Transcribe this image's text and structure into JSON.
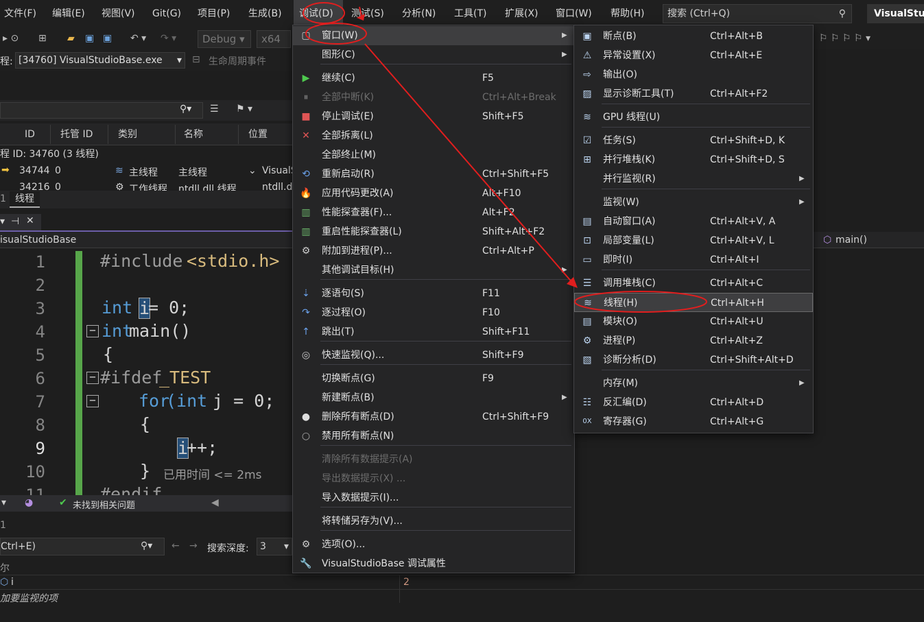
{
  "menubar": {
    "items": [
      "文件(F)",
      "编辑(E)",
      "视图(V)",
      "Git(G)",
      "项目(P)",
      "生成(B)",
      "调试(D)",
      "测试(S)",
      "分析(N)",
      "工具(T)",
      "扩展(X)",
      "窗口(W)",
      "帮助(H)"
    ],
    "search_placeholder": "搜索 (Ctrl+Q)",
    "title": "VisualStudioBase"
  },
  "toolbar": {
    "config": "Debug",
    "platform": "x64",
    "process_label": "程:",
    "process": "[34760] VisualStudioBase.exe",
    "lifecycle": "生命周期事件"
  },
  "threads": {
    "columns": [
      "ID",
      "托管 ID",
      "类别",
      "名称",
      "位置"
    ],
    "group": "程 ID: 34760 (3 线程)",
    "rows": [
      {
        "id": "34744",
        "mid": "0",
        "cat": "主线程",
        "name": "主线程",
        "loc": "VisualS"
      },
      {
        "id": "34216",
        "mid": "0",
        "cat": "工作线程",
        "name": "ntdll.dll 线程",
        "loc": "ntdll.d"
      }
    ],
    "tab": "线程",
    "tab_num": "1"
  },
  "editor": {
    "file": "isualStudioBase",
    "func": "main()",
    "lines": [
      "1",
      "2",
      "3",
      "4",
      "5",
      "6",
      "7",
      "8",
      "9",
      "10",
      "11"
    ],
    "perf": "已用时间 <= 2ms"
  },
  "code": {
    "l1a": "#include",
    "l1b": "<stdio.h>",
    "l3a": "int",
    "l3b": "i",
    "l3c": " = 0;",
    "l4a": "int",
    "l4b": " main()",
    "l5": "{",
    "l6a": "#ifdef",
    "l6b": " _TEST",
    "l7a": "for",
    "l7b": " (int",
    "l7c": " j = 0;",
    "l8": "{",
    "l9a": "i",
    "l9b": "++;",
    "l10": "}",
    "l11": "#endif"
  },
  "status": {
    "issues": "未找到相关问题"
  },
  "watch": {
    "search_hint": "Ctrl+E)",
    "depth_label": "搜索深度:",
    "depth": "3",
    "name_col": "尔",
    "var": "i",
    "value": "2",
    "add_hint": "加要监视的项",
    "num": "1"
  },
  "debug_menu": [
    {
      "label": "窗口(W)",
      "sc": "",
      "sub": true
    },
    {
      "label": "图形(C)",
      "sc": "",
      "sub": true
    },
    {
      "label": "继续(C)",
      "sc": "F5"
    },
    {
      "label": "全部中断(K)",
      "sc": "Ctrl+Alt+Break",
      "dis": true
    },
    {
      "label": "停止调试(E)",
      "sc": "Shift+F5"
    },
    {
      "label": "全部拆离(L)",
      "sc": ""
    },
    {
      "label": "全部终止(M)",
      "sc": ""
    },
    {
      "label": "重新启动(R)",
      "sc": "Ctrl+Shift+F5"
    },
    {
      "label": "应用代码更改(A)",
      "sc": "Alt+F10"
    },
    {
      "label": "性能探查器(F)...",
      "sc": "Alt+F2"
    },
    {
      "label": "重启性能探查器(L)",
      "sc": "Shift+Alt+F2"
    },
    {
      "label": "附加到进程(P)...",
      "sc": "Ctrl+Alt+P"
    },
    {
      "label": "其他调试目标(H)",
      "sc": "",
      "sub": true
    },
    {
      "label": "逐语句(S)",
      "sc": "F11"
    },
    {
      "label": "逐过程(O)",
      "sc": "F10"
    },
    {
      "label": "跳出(T)",
      "sc": "Shift+F11"
    },
    {
      "label": "快速监视(Q)...",
      "sc": "Shift+F9"
    },
    {
      "label": "切换断点(G)",
      "sc": "F9"
    },
    {
      "label": "新建断点(B)",
      "sc": "",
      "sub": true
    },
    {
      "label": "删除所有断点(D)",
      "sc": "Ctrl+Shift+F9"
    },
    {
      "label": "禁用所有断点(N)",
      "sc": ""
    },
    {
      "label": "清除所有数据提示(A)",
      "sc": "",
      "dis": true
    },
    {
      "label": "导出数据提示(X) ...",
      "sc": "",
      "dis": true
    },
    {
      "label": "导入数据提示(I)...",
      "sc": ""
    },
    {
      "label": "将转储另存为(V)...",
      "sc": ""
    },
    {
      "label": "选项(O)...",
      "sc": ""
    },
    {
      "label": "VisualStudioBase 调试属性",
      "sc": ""
    }
  ],
  "window_menu": [
    {
      "label": "断点(B)",
      "sc": "Ctrl+Alt+B"
    },
    {
      "label": "异常设置(X)",
      "sc": "Ctrl+Alt+E"
    },
    {
      "label": "输出(O)",
      "sc": ""
    },
    {
      "label": "显示诊断工具(T)",
      "sc": "Ctrl+Alt+F2"
    },
    {
      "label": "GPU 线程(U)",
      "sc": ""
    },
    {
      "label": "任务(S)",
      "sc": "Ctrl+Shift+D, K"
    },
    {
      "label": "并行堆栈(K)",
      "sc": "Ctrl+Shift+D, S"
    },
    {
      "label": "并行监视(R)",
      "sc": "",
      "sub": true
    },
    {
      "label": "监视(W)",
      "sc": "",
      "sub": true
    },
    {
      "label": "自动窗口(A)",
      "sc": "Ctrl+Alt+V, A"
    },
    {
      "label": "局部变量(L)",
      "sc": "Ctrl+Alt+V, L"
    },
    {
      "label": "即时(I)",
      "sc": "Ctrl+Alt+I"
    },
    {
      "label": "调用堆栈(C)",
      "sc": "Ctrl+Alt+C"
    },
    {
      "label": "线程(H)",
      "sc": "Ctrl+Alt+H"
    },
    {
      "label": "模块(O)",
      "sc": "Ctrl+Alt+U"
    },
    {
      "label": "进程(P)",
      "sc": "Ctrl+Alt+Z"
    },
    {
      "label": "诊断分析(D)",
      "sc": "Ctrl+Shift+Alt+D"
    },
    {
      "label": "内存(M)",
      "sc": "",
      "sub": true
    },
    {
      "label": "反汇编(D)",
      "sc": "Ctrl+Alt+D"
    },
    {
      "label": "寄存器(G)",
      "sc": "Ctrl+Alt+G"
    }
  ]
}
